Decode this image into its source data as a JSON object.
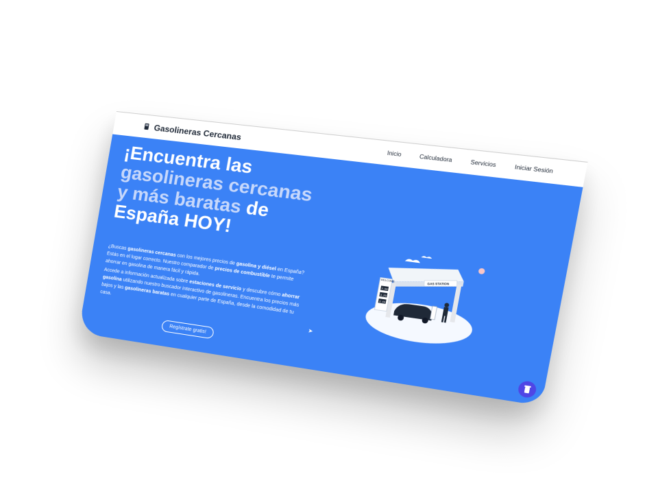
{
  "header": {
    "brand": "Gasolineras Cercanas",
    "brand_icon": "fuel-pump-icon",
    "nav": {
      "home": "Inicio",
      "calculator": "Calculadora",
      "services": "Servicios",
      "login": "Iniciar Sesión"
    }
  },
  "hero": {
    "title_part1": "¡Encuentra las",
    "title_part2": "gasolineras cercanas y más baratas",
    "title_part3": "de España",
    "title_part4": "HOY!",
    "p1": {
      "t1": "¿Buscas ",
      "b1": "gasolineras cercanas",
      "t2": " con los mejores precios de ",
      "b2": "gasolina y diésel",
      "t3": " en España? Estás en el lugar correcto. Nuestro comparador de ",
      "b3": "precios de combustible",
      "t4": " te permite ahorrar en gasolina de manera fácil y rápida."
    },
    "p2": {
      "t1": "Accede a información actualizada sobre ",
      "b1": "estaciones de servicio",
      "t2": " y descubre cómo ",
      "b2": "ahorrar gasolina",
      "t3": " utilizando nuestro buscador interactivo de gasolineras. Encuentra los precios más bajos y las ",
      "b3": "gasolineras baratas",
      "t4": " en cualquier parte de España, desde la comodidad de tu casa."
    },
    "cta": "Regístrate gratis!",
    "illustration": {
      "sign": "GAS STATION",
      "welcome": "WELCOME",
      "prices": [
        "2.99",
        "3.29",
        "3.49"
      ]
    }
  },
  "colors": {
    "primary": "#3b82f6",
    "accent_text": "#c7d8fb",
    "float_button": "#4f46e5"
  }
}
